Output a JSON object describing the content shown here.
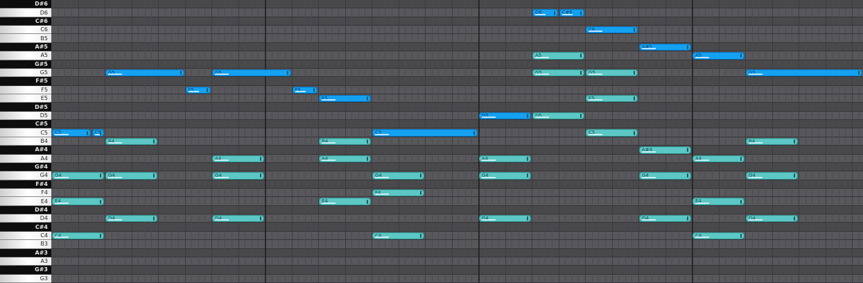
{
  "piano_roll": {
    "keys": [
      {
        "name": "D#6",
        "black": true
      },
      {
        "name": "D6",
        "black": false
      },
      {
        "name": "C#6",
        "black": true
      },
      {
        "name": "C6",
        "black": false
      },
      {
        "name": "B5",
        "black": false
      },
      {
        "name": "A#5",
        "black": true
      },
      {
        "name": "A5",
        "black": false
      },
      {
        "name": "G#5",
        "black": true
      },
      {
        "name": "G5",
        "black": false
      },
      {
        "name": "F#5",
        "black": true
      },
      {
        "name": "F5",
        "black": false
      },
      {
        "name": "E5",
        "black": false
      },
      {
        "name": "D#5",
        "black": true
      },
      {
        "name": "D5",
        "black": false
      },
      {
        "name": "C#5",
        "black": true
      },
      {
        "name": "C5",
        "black": false
      },
      {
        "name": "B4",
        "black": false
      },
      {
        "name": "A#4",
        "black": true
      },
      {
        "name": "A4",
        "black": false
      },
      {
        "name": "G#4",
        "black": true
      },
      {
        "name": "G4",
        "black": false
      },
      {
        "name": "F#4",
        "black": true
      },
      {
        "name": "F4",
        "black": false
      },
      {
        "name": "E4",
        "black": false
      },
      {
        "name": "D#4",
        "black": true
      },
      {
        "name": "D4",
        "black": false
      },
      {
        "name": "C#4",
        "black": true
      },
      {
        "name": "C4",
        "black": false
      },
      {
        "name": "B3",
        "black": false
      },
      {
        "name": "A#3",
        "black": true
      },
      {
        "name": "A3",
        "black": false
      },
      {
        "name": "G#3",
        "black": true
      },
      {
        "name": "G3",
        "black": false
      }
    ],
    "notes": [
      {
        "label": "C5",
        "pitch": "C5",
        "start": 0,
        "len": 1.5,
        "selected": true
      },
      {
        "label": "C5",
        "pitch": "C5",
        "start": 1.5,
        "len": 0.5,
        "selected": true
      },
      {
        "label": "G4",
        "pitch": "G4",
        "start": 0,
        "len": 2,
        "selected": false
      },
      {
        "label": "E4",
        "pitch": "E4",
        "start": 0,
        "len": 2,
        "selected": false
      },
      {
        "label": "C4",
        "pitch": "C4",
        "start": 0,
        "len": 2,
        "selected": false
      },
      {
        "label": "G5",
        "pitch": "G5",
        "start": 2,
        "len": 3,
        "selected": true
      },
      {
        "label": "B4",
        "pitch": "B4",
        "start": 2,
        "len": 2,
        "selected": false
      },
      {
        "label": "G4",
        "pitch": "G4",
        "start": 2,
        "len": 2,
        "selected": false
      },
      {
        "label": "D4",
        "pitch": "D4",
        "start": 2,
        "len": 2,
        "selected": false
      },
      {
        "label": "F5",
        "pitch": "F5",
        "start": 5,
        "len": 1,
        "selected": true
      },
      {
        "label": "G5",
        "pitch": "G5",
        "start": 6,
        "len": 3,
        "selected": true
      },
      {
        "label": "A4",
        "pitch": "A4",
        "start": 6,
        "len": 2,
        "selected": false
      },
      {
        "label": "G4",
        "pitch": "G4",
        "start": 6,
        "len": 2,
        "selected": false
      },
      {
        "label": "D4",
        "pitch": "D4",
        "start": 6,
        "len": 2,
        "selected": false
      },
      {
        "label": "F5",
        "pitch": "F5",
        "start": 9,
        "len": 1,
        "selected": true
      },
      {
        "label": "E5",
        "pitch": "E5",
        "start": 10,
        "len": 2,
        "selected": true
      },
      {
        "label": "B4",
        "pitch": "B4",
        "start": 10,
        "len": 2,
        "selected": false
      },
      {
        "label": "A4",
        "pitch": "A4",
        "start": 10,
        "len": 2,
        "selected": false
      },
      {
        "label": "E4",
        "pitch": "E4",
        "start": 10,
        "len": 2,
        "selected": false
      },
      {
        "label": "C5",
        "pitch": "C5",
        "start": 12,
        "len": 4,
        "selected": true
      },
      {
        "label": "G4",
        "pitch": "G4",
        "start": 12,
        "len": 2,
        "selected": false
      },
      {
        "label": "F4",
        "pitch": "F4",
        "start": 12,
        "len": 2,
        "selected": false
      },
      {
        "label": "C4",
        "pitch": "C4",
        "start": 12,
        "len": 2,
        "selected": false
      },
      {
        "label": "D5",
        "pitch": "D5",
        "start": 16,
        "len": 2,
        "selected": true
      },
      {
        "label": "A4",
        "pitch": "A4",
        "start": 16,
        "len": 2,
        "selected": false
      },
      {
        "label": "G4",
        "pitch": "G4",
        "start": 16,
        "len": 2,
        "selected": false
      },
      {
        "label": "D4",
        "pitch": "D4",
        "start": 16,
        "len": 2,
        "selected": false
      },
      {
        "label": "D6",
        "pitch": "D6",
        "start": 18,
        "len": 1,
        "selected": true
      },
      {
        "label": "C#6",
        "pitch": "D6",
        "start": 19,
        "len": 1,
        "selected": true
      },
      {
        "label": "A5",
        "pitch": "A5",
        "start": 18,
        "len": 2,
        "selected": false
      },
      {
        "label": "G5",
        "pitch": "G5",
        "start": 18,
        "len": 2,
        "selected": false
      },
      {
        "label": "D5",
        "pitch": "D5",
        "start": 18,
        "len": 2,
        "selected": false
      },
      {
        "label": "C6",
        "pitch": "C6",
        "start": 20,
        "len": 2,
        "selected": true
      },
      {
        "label": "G5",
        "pitch": "G5",
        "start": 20,
        "len": 2,
        "selected": false
      },
      {
        "label": "E5",
        "pitch": "E5",
        "start": 20,
        "len": 2,
        "selected": false
      },
      {
        "label": "C5",
        "pitch": "C5",
        "start": 20,
        "len": 2,
        "selected": false
      },
      {
        "label": "A#5",
        "pitch": "A#5",
        "start": 22,
        "len": 2,
        "selected": true
      },
      {
        "label": "A#4",
        "pitch": "A#4",
        "start": 22,
        "len": 2,
        "selected": false
      },
      {
        "label": "G4",
        "pitch": "G4",
        "start": 22,
        "len": 2,
        "selected": false
      },
      {
        "label": "D4",
        "pitch": "D4",
        "start": 22,
        "len": 2,
        "selected": false
      },
      {
        "label": "A5",
        "pitch": "A5",
        "start": 24,
        "len": 2,
        "selected": true
      },
      {
        "label": "A4",
        "pitch": "A4",
        "start": 24,
        "len": 2,
        "selected": false
      },
      {
        "label": "E4",
        "pitch": "E4",
        "start": 24,
        "len": 2,
        "selected": false
      },
      {
        "label": "C4",
        "pitch": "C4",
        "start": 24,
        "len": 2,
        "selected": false
      },
      {
        "label": "G5",
        "pitch": "G5",
        "start": 26,
        "len": 4.5,
        "selected": true
      },
      {
        "label": "B4",
        "pitch": "B4",
        "start": 26,
        "len": 2,
        "selected": false
      },
      {
        "label": "G4",
        "pitch": "G4",
        "start": 26,
        "len": 2,
        "selected": false
      },
      {
        "label": "D4",
        "pitch": "D4",
        "start": 26,
        "len": 2,
        "selected": false
      }
    ]
  },
  "colors": {
    "selected_note": "#15a1f2",
    "unselected_note": "#5cc7c4",
    "white_row": "#58585c",
    "black_row": "#49494c",
    "black_key": "#0d0d0d"
  }
}
